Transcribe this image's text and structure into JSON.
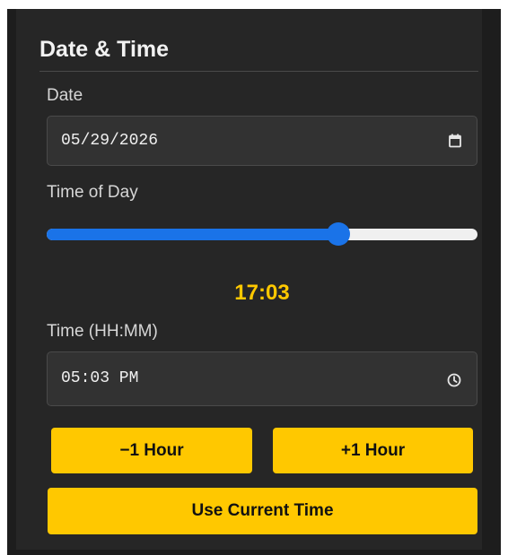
{
  "section": {
    "title": "Date & Time"
  },
  "date": {
    "label": "Date",
    "value": "05/29/2026",
    "icon": "calendar-icon"
  },
  "time_of_day": {
    "label": "Time of Day",
    "slider_fraction": 0.687,
    "display": "17:03"
  },
  "time_input": {
    "label": "Time (HH:MM)",
    "value": "05:03 PM",
    "icon": "clock-icon"
  },
  "buttons": {
    "minus_hour": "−1 Hour",
    "plus_hour": "+1 Hour",
    "current_time": "Use Current Time"
  },
  "colors": {
    "accent": "#ffc800",
    "slider": "#1a73e8",
    "panel": "#262626"
  }
}
